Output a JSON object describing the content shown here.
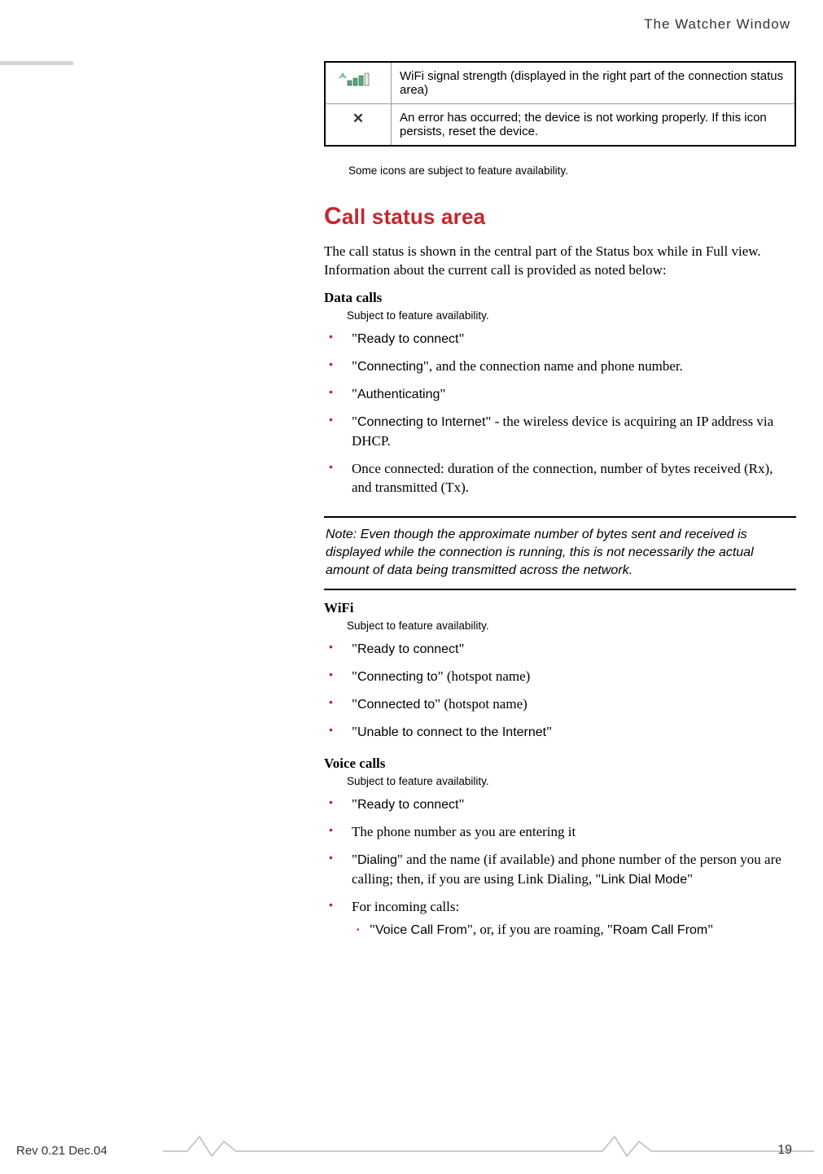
{
  "header": {
    "title": "The Watcher Window"
  },
  "table": {
    "row1": {
      "iconName": "wifi-icon",
      "desc": "WiFi signal strength (displayed in the right part of the connection status area)"
    },
    "row2": {
      "iconName": "error-icon",
      "iconGlyph": "✕",
      "desc": "An error has occurred; the device is not working properly. If this icon persists, reset the device."
    }
  },
  "caption": "Some icons are subject to feature availability.",
  "sectionTitle": "all status area",
  "sectionTitleFirst": "C",
  "intro": "The call status is shown in the central part of the Status box while in Full view. Information about the current call is provided as noted below:",
  "dataCalls": {
    "heading": "Data calls",
    "sub": "Subject to feature availability.",
    "items": [
      {
        "pre": "\"",
        "sans": "Ready to connect",
        "post": "\""
      },
      {
        "pre": "\"",
        "sans": "Connecting",
        "post": "\", and the connection name and phone number."
      },
      {
        "pre": "\"",
        "sans": "Authenticating",
        "post": "\""
      },
      {
        "pre": "\"",
        "sans": "Connecting to Internet",
        "post": "\" - the wireless device is acquiring an IP address via DHCP."
      },
      {
        "plain": "Once connected: duration of the connection, number of bytes received (Rx), and transmitted (Tx)."
      }
    ]
  },
  "note": {
    "label": "Note:  ",
    "text": "Even though the approximate number of bytes sent and received is displayed while the connection is running, this is not necessarily the actual amount of data being transmitted across the network."
  },
  "wifi": {
    "heading": "WiFi",
    "sub": "Subject to feature availability.",
    "items": [
      {
        "pre": "\"",
        "sans": "Ready to connect",
        "post": "\""
      },
      {
        "pre": "\"",
        "sans": "Connecting to",
        "post": "\" (hotspot name)"
      },
      {
        "pre": "\"",
        "sans": "Connected to",
        "post": "\" (hotspot name)"
      },
      {
        "pre": "\"",
        "sans": "Unable to connect to the Internet",
        "post": "\""
      }
    ]
  },
  "voice": {
    "heading": "Voice calls",
    "sub": "Subject to feature availability.",
    "items": [
      {
        "pre": "\"",
        "sans": "Ready to connect",
        "post": "\""
      },
      {
        "plain": "The phone number as you are entering it"
      },
      {
        "pre": "\"",
        "sans": "Dialing",
        "post": "\" and the name (if available) and phone number of the person you are calling; then, if you are using Link Dialing, \"",
        "sans2": "Link Dial Mode",
        "post2": "\""
      },
      {
        "plain": "For incoming calls:",
        "sub": [
          {
            "pre": "\"",
            "sans": "Voice Call From",
            "post": "\", or, if you are roaming, \"",
            "sans2": "Roam Call From",
            "post2": "\""
          }
        ]
      }
    ]
  },
  "footer": {
    "left": "Rev 0.21  Dec.04",
    "right": "19"
  }
}
